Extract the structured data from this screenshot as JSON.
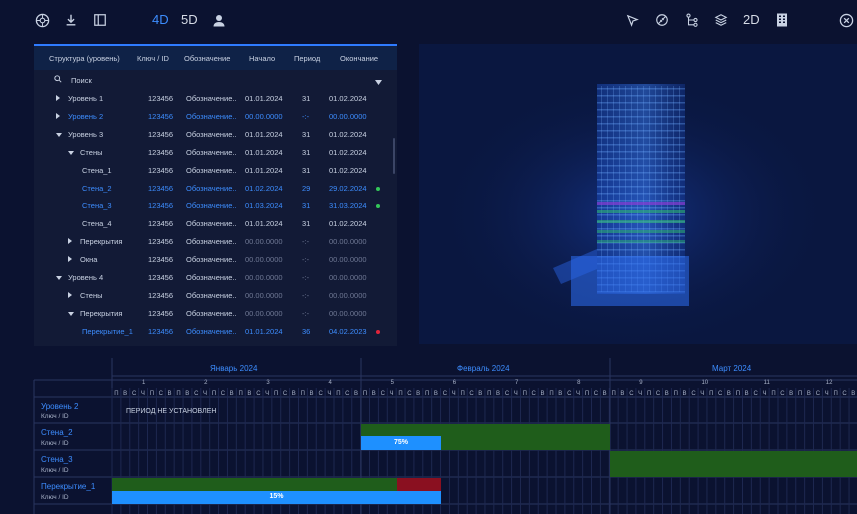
{
  "toolbar": {
    "left_icons": [
      "globe-icon",
      "download-icon",
      "panel-icon"
    ],
    "mode_4d": "4D",
    "mode_5d": "5D",
    "user_icon": "person-icon",
    "right_icons": [
      "cursor-icon",
      "ruler-icon",
      "hierarchy-icon",
      "layers-icon"
    ],
    "mode_2d": "2D",
    "grid_icon": "building-icon",
    "close_icon": "close-icon"
  },
  "table": {
    "headers": [
      "Структура (уровень)",
      "Ключ / ID",
      "Обозначение",
      "Начало",
      "Период",
      "Окончание"
    ],
    "search_label": "Поиск",
    "rows": [
      {
        "name": "Уровень 1",
        "key": "123456",
        "desig": "Обозначение..",
        "start": "01.01.2024",
        "period": "31",
        "end": "01.02.2024",
        "blue": false,
        "grey": false,
        "caret": "right",
        "dot": ""
      },
      {
        "name": "Уровень 2",
        "key": "123456",
        "desig": "Обозначение..",
        "start": "00.00.0000",
        "period": "-:-",
        "end": "00.00.0000",
        "blue": true,
        "grey": false,
        "caret": "right",
        "dot": ""
      },
      {
        "name": "Уровень 3",
        "key": "123456",
        "desig": "Обозначение..",
        "start": "01.01.2024",
        "period": "31",
        "end": "01.02.2024",
        "blue": false,
        "grey": false,
        "caret": "down",
        "dot": ""
      },
      {
        "name": "Стены",
        "key": "123456",
        "desig": "Обозначение..",
        "start": "01.01.2024",
        "period": "31",
        "end": "01.02.2024",
        "blue": false,
        "grey": false,
        "caret": "down",
        "dot": ""
      },
      {
        "name": "Стена_1",
        "key": "123456",
        "desig": "Обозначение..",
        "start": "01.01.2024",
        "period": "31",
        "end": "01.02.2024",
        "blue": false,
        "grey": false,
        "caret": "",
        "dot": ""
      },
      {
        "name": "Стена_2",
        "key": "123456",
        "desig": "Обозначение..",
        "start": "01.02.2024",
        "period": "29",
        "end": "29.02.2024",
        "blue": true,
        "grey": false,
        "caret": "",
        "dot": "#34c759"
      },
      {
        "name": "Стена_3",
        "key": "123456",
        "desig": "Обозначение..",
        "start": "01.03.2024",
        "period": "31",
        "end": "31.03.2024",
        "blue": true,
        "grey": false,
        "caret": "",
        "dot": "#34c759"
      },
      {
        "name": "Стена_4",
        "key": "123456",
        "desig": "Обозначение..",
        "start": "01.01.2024",
        "period": "31",
        "end": "01.02.2024",
        "blue": false,
        "grey": false,
        "caret": "",
        "dot": ""
      },
      {
        "name": "Перекрытия",
        "key": "123456",
        "desig": "Обозначение..",
        "start": "00.00.0000",
        "period": "-:-",
        "end": "00.00.0000",
        "blue": false,
        "grey": true,
        "caret": "right",
        "dot": ""
      },
      {
        "name": "Окна",
        "key": "123456",
        "desig": "Обозначение..",
        "start": "00.00.0000",
        "period": "-:-",
        "end": "00.00.0000",
        "blue": false,
        "grey": true,
        "caret": "right",
        "dot": ""
      },
      {
        "name": "Уровень 4",
        "key": "123456",
        "desig": "Обозначение..",
        "start": "00.00.0000",
        "period": "-:-",
        "end": "00.00.0000",
        "blue": false,
        "grey": true,
        "caret": "down",
        "dot": ""
      },
      {
        "name": "Стены",
        "key": "123456",
        "desig": "Обозначение..",
        "start": "00.00.0000",
        "period": "-:-",
        "end": "00.00.0000",
        "blue": false,
        "grey": true,
        "caret": "right",
        "dot": ""
      },
      {
        "name": "Перекрытия",
        "key": "123456",
        "desig": "Обозначение..",
        "start": "00.00.0000",
        "period": "-:-",
        "end": "00.00.0000",
        "blue": false,
        "grey": true,
        "caret": "down",
        "dot": ""
      },
      {
        "name": "Перекрытие_1",
        "key": "123456",
        "desig": "Обозначение..",
        "start": "01.01.2024",
        "period": "36",
        "end": "04.02.2023",
        "blue": true,
        "grey": false,
        "caret": "",
        "dot": "#e0243a"
      }
    ]
  },
  "gantt": {
    "months": [
      "Январь 2024",
      "Февраль 2024",
      "Март 2024"
    ],
    "weeks": [
      "1",
      "2",
      "3",
      "4",
      "5",
      "6",
      "7",
      "8",
      "9",
      "10",
      "11",
      "12"
    ],
    "day_letters": "ПВСЧПСВ",
    "rows": [
      {
        "name": "Уровень 2",
        "sub": "Ключ / ID",
        "note": "ПЕРИОД НЕ УСТАНОВЛЕН"
      },
      {
        "name": "Стена_2",
        "sub": "Ключ / ID",
        "progress_label": "75%",
        "progress": 0.75
      },
      {
        "name": "Стена_3",
        "sub": "Ключ / ID"
      },
      {
        "name": "Перекрытие_1",
        "sub": "Ключ / ID",
        "progress_label": "15%",
        "progress": 0.15
      }
    ]
  }
}
